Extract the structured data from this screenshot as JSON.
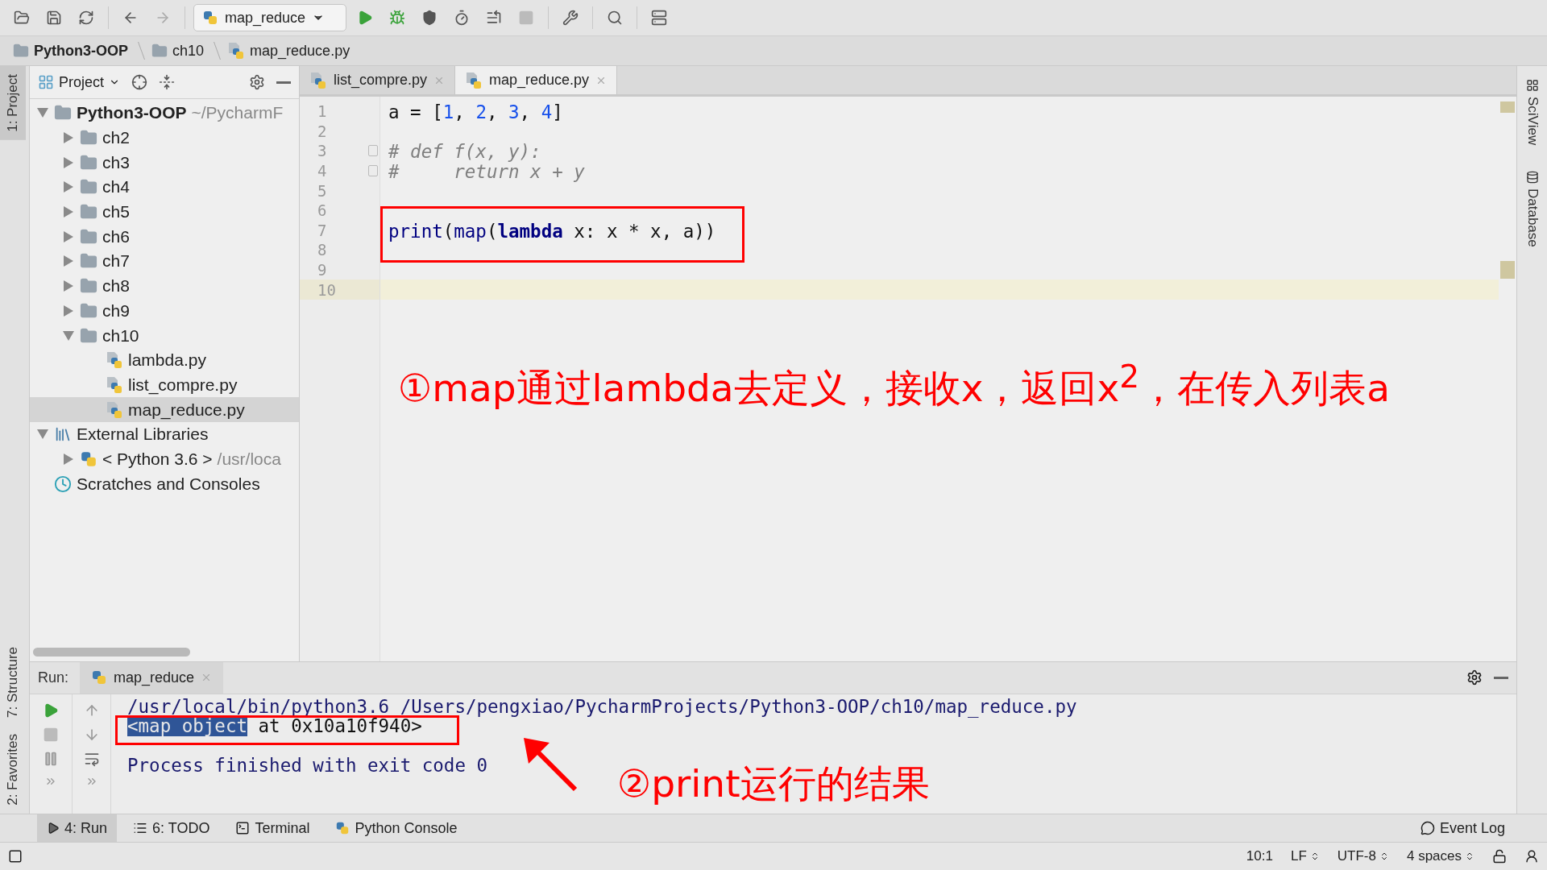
{
  "toolbar": {
    "run_config": "map_reduce"
  },
  "breadcrumbs": [
    {
      "label": "Python3-OOP",
      "kind": "project"
    },
    {
      "label": "ch10",
      "kind": "folder"
    },
    {
      "label": "map_reduce.py",
      "kind": "file"
    }
  ],
  "left_stripe": {
    "top": [
      {
        "label": "1: Project",
        "selected": true
      }
    ],
    "bottom": [
      {
        "label": "7: Structure",
        "selected": false
      },
      {
        "label": "2: Favorites",
        "selected": false
      }
    ]
  },
  "right_stripe": [
    {
      "label": "SciView",
      "kind": "sciview"
    },
    {
      "label": "Database",
      "kind": "database"
    }
  ],
  "project_panel": {
    "title": "Project",
    "tree": [
      {
        "label": "Python3-OOP",
        "hint": "~/PycharmF",
        "kind": "root",
        "expanded": true,
        "selected": false,
        "children": [
          {
            "label": "ch2",
            "kind": "folder",
            "expanded": false,
            "selected": false
          },
          {
            "label": "ch3",
            "kind": "folder",
            "expanded": false,
            "selected": false
          },
          {
            "label": "ch4",
            "kind": "folder",
            "expanded": false,
            "selected": false
          },
          {
            "label": "ch5",
            "kind": "folder",
            "expanded": false,
            "selected": false
          },
          {
            "label": "ch6",
            "kind": "folder",
            "expanded": false,
            "selected": false
          },
          {
            "label": "ch7",
            "kind": "folder",
            "expanded": false,
            "selected": false
          },
          {
            "label": "ch8",
            "kind": "folder",
            "expanded": false,
            "selected": false
          },
          {
            "label": "ch9",
            "kind": "folder",
            "expanded": false,
            "selected": false
          },
          {
            "label": "ch10",
            "kind": "folder",
            "expanded": true,
            "selected": false,
            "children": [
              {
                "label": "lambda.py",
                "kind": "file",
                "selected": false
              },
              {
                "label": "list_compre.py",
                "kind": "file",
                "selected": false
              },
              {
                "label": "map_reduce.py",
                "kind": "file",
                "selected": true
              }
            ]
          }
        ]
      },
      {
        "label": "External Libraries",
        "kind": "library",
        "expanded": true,
        "selected": false,
        "children": [
          {
            "label": "< Python 3.6 >",
            "hint": "/usr/loca",
            "kind": "sdk",
            "expanded": false,
            "selected": false
          }
        ]
      },
      {
        "label": "Scratches and Consoles",
        "kind": "scratches",
        "selected": false
      }
    ]
  },
  "editor": {
    "tabs": [
      {
        "label": "list_compre.py",
        "selected": false
      },
      {
        "label": "map_reduce.py",
        "selected": true
      }
    ],
    "lines": [
      {
        "number": "1",
        "current": false,
        "tokens": [
          {
            "text": "a = [",
            "kind": "plain"
          },
          {
            "text": "1",
            "kind": "number"
          },
          {
            "text": ", ",
            "kind": "plain"
          },
          {
            "text": "2",
            "kind": "number"
          },
          {
            "text": ", ",
            "kind": "plain"
          },
          {
            "text": "3",
            "kind": "number"
          },
          {
            "text": ", ",
            "kind": "plain"
          },
          {
            "text": "4",
            "kind": "number"
          },
          {
            "text": "]",
            "kind": "plain"
          }
        ]
      },
      {
        "number": "2",
        "current": false
      },
      {
        "number": "3",
        "current": false,
        "fold": true,
        "tokens": [
          {
            "text": "# def f(x, y):",
            "kind": "comment"
          }
        ]
      },
      {
        "number": "4",
        "current": false,
        "fold": true,
        "tokens": [
          {
            "text": "#     return x + y",
            "kind": "comment"
          }
        ]
      },
      {
        "number": "5",
        "current": false
      },
      {
        "number": "6",
        "current": false
      },
      {
        "number": "7",
        "current": false,
        "tokens": [
          {
            "text": "print",
            "kind": "builtin"
          },
          {
            "text": "(",
            "kind": "plain"
          },
          {
            "text": "map",
            "kind": "builtin"
          },
          {
            "text": "(",
            "kind": "plain"
          },
          {
            "text": "lambda",
            "kind": "keyword"
          },
          {
            "text": " x: x * x, a))",
            "kind": "plain"
          }
        ]
      },
      {
        "number": "8",
        "current": false
      },
      {
        "number": "9",
        "current": false
      },
      {
        "number": "10",
        "current": true
      }
    ],
    "note": "①map通过lambda去定义，接收x，返回x$^{2}$，在传入列表a"
  },
  "run_panel": {
    "label": "Run:",
    "tab": "map_reduce",
    "output": [
      {
        "kind": "command",
        "segments": [
          {
            "text": "/usr/local/bin/python3.6 /Users/pengxiao/PycharmProjects/Python3-OOP/ch10/map_reduce.py",
            "selected": false
          }
        ]
      },
      {
        "kind": "result",
        "segments": [
          {
            "text": "<map object",
            "selected": true
          },
          {
            "text": " at 0x10a10f940>",
            "selected": false
          }
        ]
      },
      {
        "kind": "blank"
      },
      {
        "kind": "exit",
        "segments": [
          {
            "text": "Process finished with exit code 0",
            "selected": false
          }
        ]
      }
    ],
    "note": "②print运行的结果"
  },
  "bottom_tabs": [
    {
      "label": "4: Run",
      "kind": "run",
      "selected": true
    },
    {
      "label": "6: TODO",
      "kind": "todo",
      "selected": false
    },
    {
      "label": "Terminal",
      "kind": "terminal",
      "selected": false
    },
    {
      "label": "Python Console",
      "kind": "console",
      "selected": false
    }
  ],
  "event_log": "Event Log",
  "status_bar": {
    "position": "10:1",
    "line_separator": "LF",
    "encoding": "UTF-8",
    "indent": "4 spaces"
  }
}
